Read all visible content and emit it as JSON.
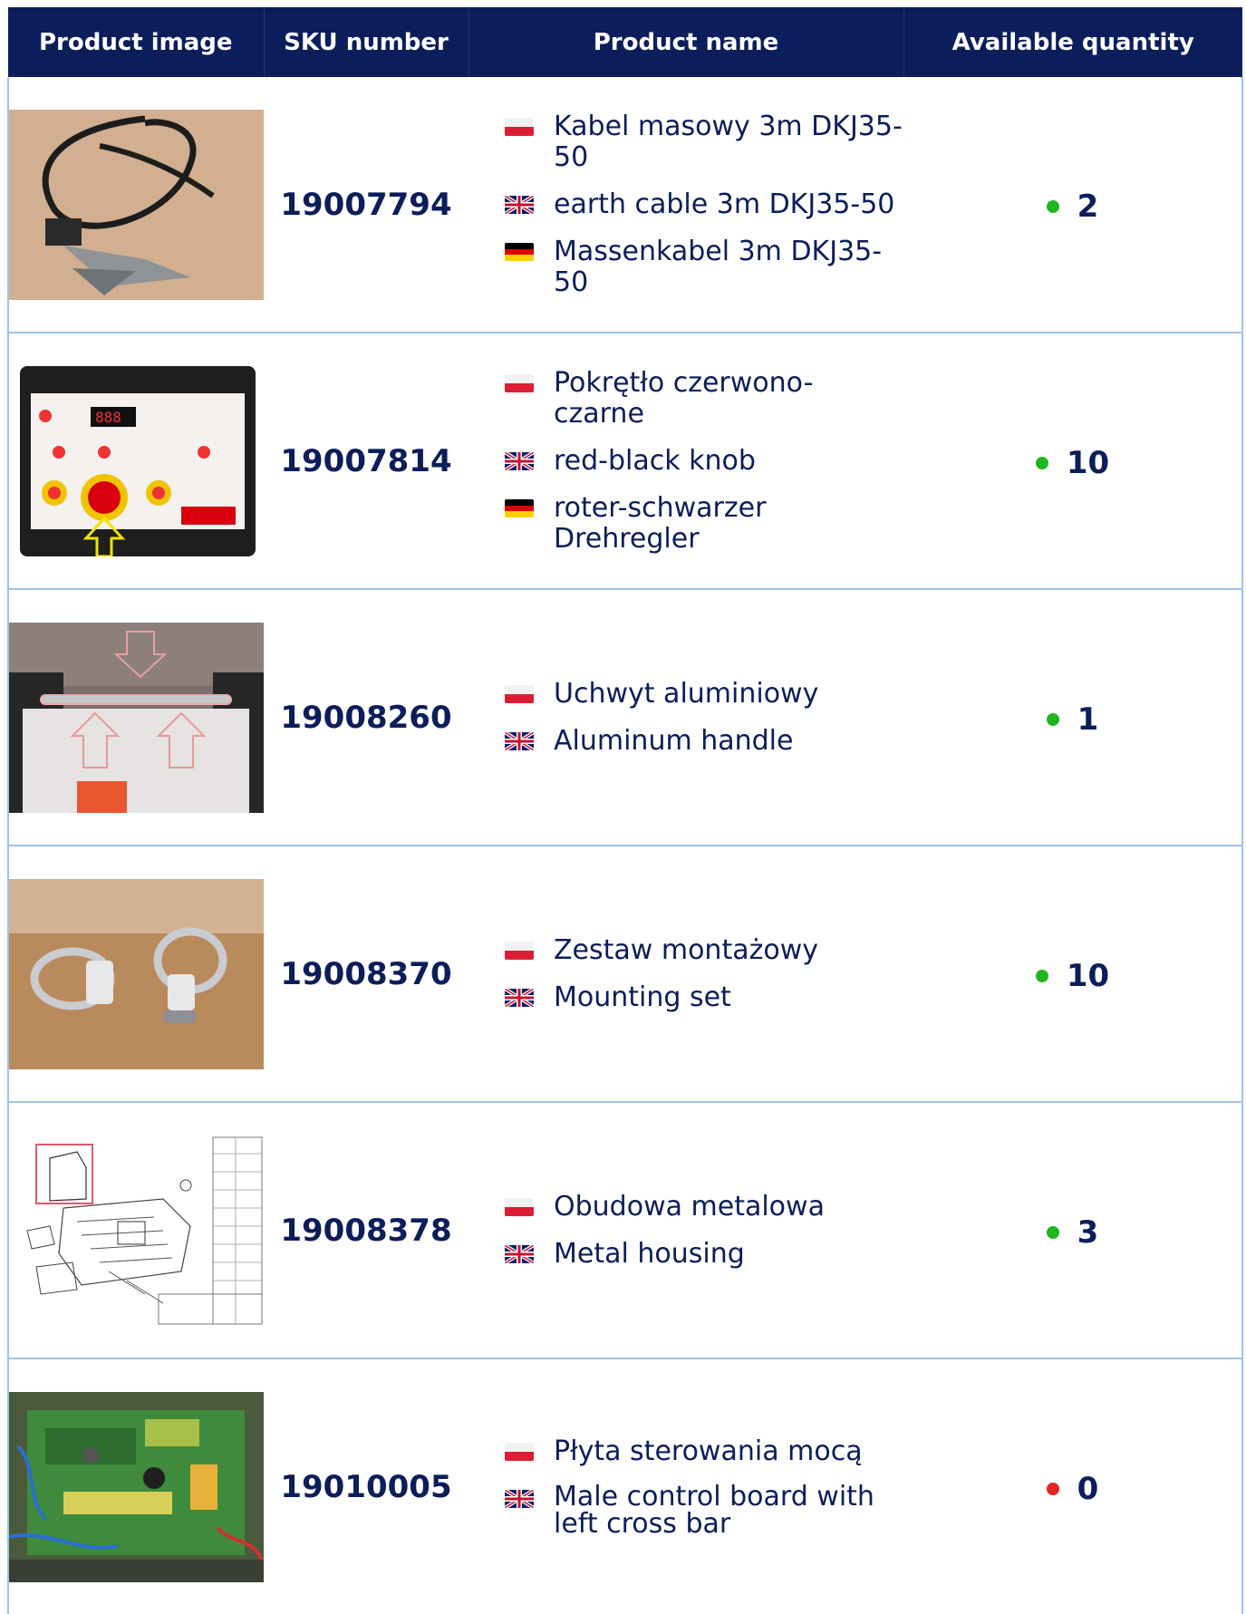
{
  "headers": {
    "image": "Product image",
    "sku": "SKU number",
    "name": "Product name",
    "qty": "Available quantity"
  },
  "colors": {
    "header_bg": "#0b1e5b",
    "border": "#9cc4e8",
    "in_stock": "#1fb61f",
    "out_of_stock": "#e52424"
  },
  "rows": [
    {
      "sku": "19007794",
      "qty": "2",
      "status": "in-stock",
      "names": [
        {
          "flag": "pl",
          "text": "Kabel masowy 3m DKJ35-50"
        },
        {
          "flag": "gb",
          "text": "earth cable 3m DKJ35-50"
        },
        {
          "flag": "de",
          "text": "Massenkabel 3m DKJ35-50"
        }
      ]
    },
    {
      "sku": "19007814",
      "qty": "10",
      "status": "in-stock",
      "names": [
        {
          "flag": "pl",
          "text": "Pokrętło czerwono-czarne"
        },
        {
          "flag": "gb",
          "text": "red-black knob"
        },
        {
          "flag": "de",
          "text": "roter-schwarzer Drehregler"
        }
      ]
    },
    {
      "sku": "19008260",
      "qty": "1",
      "status": "in-stock",
      "names": [
        {
          "flag": "pl",
          "text": "Uchwyt aluminiowy"
        },
        {
          "flag": "gb",
          "text": "Aluminum handle"
        }
      ]
    },
    {
      "sku": "19008370",
      "qty": "10",
      "status": "in-stock",
      "names": [
        {
          "flag": "pl",
          "text": "Zestaw montażowy"
        },
        {
          "flag": "gb",
          "text": "Mounting set"
        }
      ]
    },
    {
      "sku": "19008378",
      "qty": "3",
      "status": "in-stock",
      "names": [
        {
          "flag": "pl",
          "text": "Obudowa metalowa"
        },
        {
          "flag": "gb",
          "text": "Metal housing"
        }
      ]
    },
    {
      "sku": "19010005",
      "qty": "0",
      "status": "out-of-stock",
      "names": [
        {
          "flag": "pl",
          "text": "Płyta sterowania mocą"
        },
        {
          "flag": "gb",
          "text": "Male control board with left cross bar"
        }
      ]
    }
  ]
}
